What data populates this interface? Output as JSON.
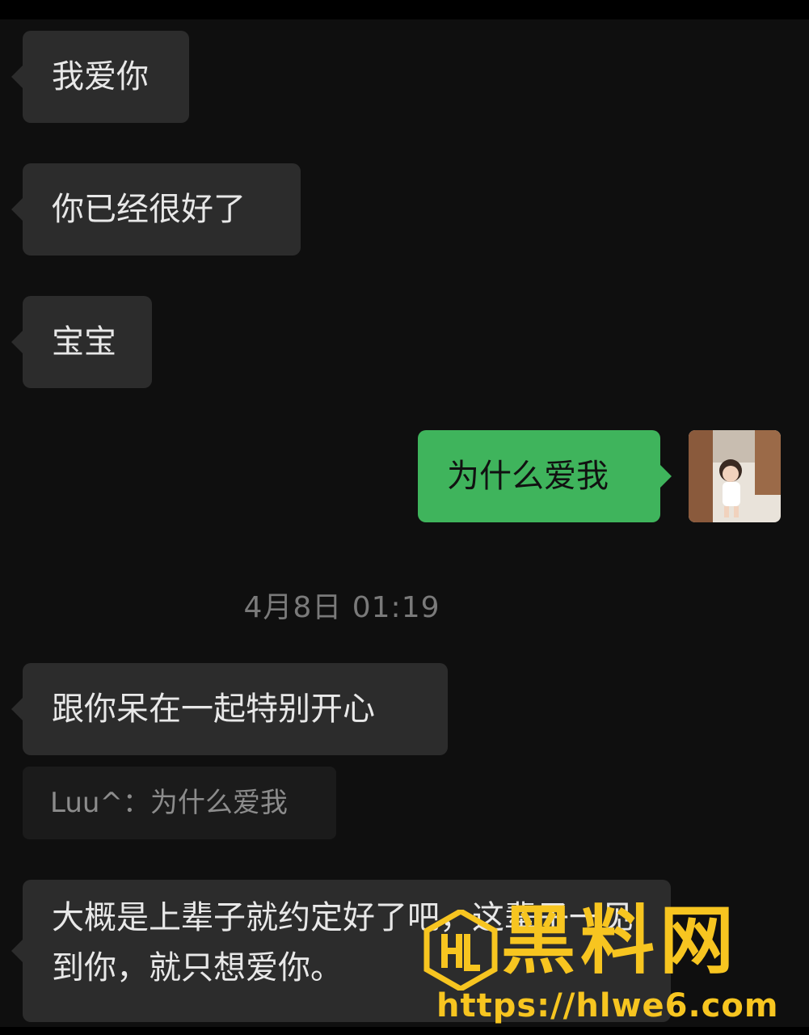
{
  "messages": [
    {
      "text": "我爱你"
    },
    {
      "text": "你已经很好了"
    },
    {
      "text": "宝宝"
    },
    {
      "text": "为什么爱我"
    },
    {
      "text": "跟你呆在一起特别开心"
    },
    {
      "text": "大概是上辈子就约定好了吧，这辈子一见到你，就只想爱你。"
    }
  ],
  "timestamp": "4月8日 01:19",
  "quote": {
    "text": "Luu^：为什么爱我"
  },
  "watermark": {
    "title": "黑料网",
    "url": "https://hlwe6.com",
    "logo_text": "HL"
  },
  "colors": {
    "background": "#0f0f0f",
    "incoming_bubble": "#2c2c2c",
    "outgoing_bubble": "#3fb45c",
    "watermark": "#f7c520"
  }
}
